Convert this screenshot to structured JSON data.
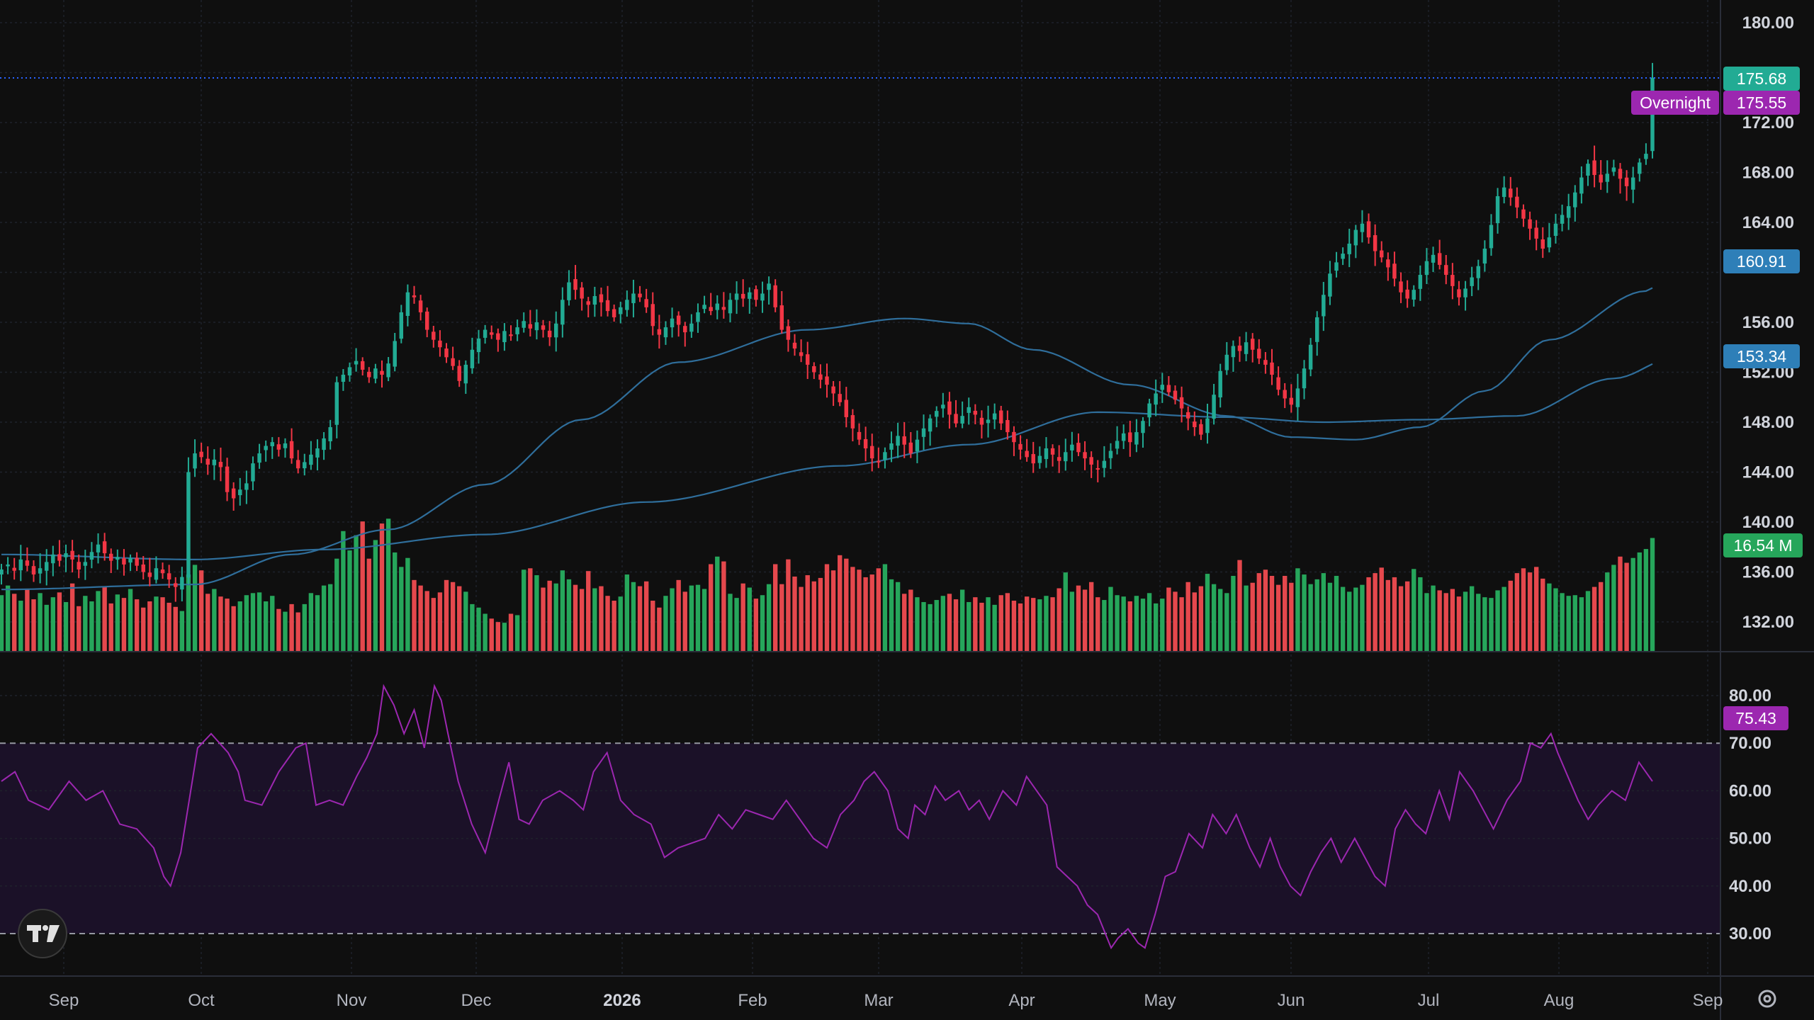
{
  "theme": {
    "background": "#0f0f0f",
    "up_color": "#22ab94",
    "down_color": "#f23645",
    "volume_up": "#26a65b",
    "volume_down": "#e5484d",
    "ma_color": "#2f6e9b",
    "rsi_color": "#9c27b0",
    "rsi_band": "#1b1128"
  },
  "header": {
    "logo_icon": "tradingview-logo-icon",
    "settings_icon": "gear-icon"
  },
  "price_axis": {
    "labels": [
      "180.00",
      "172.00",
      "168.00",
      "164.00",
      "156.00",
      "152.00",
      "148.00",
      "144.00",
      "140.00",
      "136.00",
      "132.00"
    ],
    "values": [
      180,
      172,
      168,
      164,
      156,
      152,
      148,
      144,
      140,
      136,
      132
    ]
  },
  "rsi_axis": {
    "labels": [
      "80.00",
      "70.00",
      "60.00",
      "50.00",
      "40.00",
      "30.00"
    ],
    "values": [
      80,
      70,
      60,
      50,
      40,
      30
    ]
  },
  "time_axis": {
    "labels": [
      "Sep",
      "Oct",
      "Nov",
      "Dec",
      "2026",
      "Feb",
      "Mar",
      "Apr",
      "May",
      "Jun",
      "Jul",
      "Aug",
      "Sep"
    ],
    "bold_index": 4
  },
  "tags": {
    "last_price": "175.68",
    "overnight_label": "Overnight",
    "overnight_price": "175.55",
    "ma_short": "160.91",
    "ma_long": "153.34",
    "volume": "16.54 M",
    "rsi": "75.43"
  },
  "chart_data": [
    {
      "type": "candlestick",
      "name": "price",
      "x_range": [
        "Sep",
        "Aug"
      ],
      "ylim": [
        130,
        182
      ],
      "closes": [
        136.2,
        136.6,
        136.1,
        137.0,
        136.5,
        135.8,
        136.3,
        136.8,
        137.4,
        136.9,
        137.5,
        137.0,
        136.2,
        136.8,
        137.6,
        138.2,
        137.5,
        136.9,
        137.2,
        136.6,
        137.1,
        136.5,
        136.0,
        135.6,
        136.3,
        135.9,
        135.4,
        134.8,
        135.6,
        144.0,
        145.5,
        145.2,
        144.6,
        145.0,
        144.4,
        142.4,
        141.9,
        142.6,
        143.1,
        144.7,
        145.5,
        146.1,
        146.4,
        145.8,
        146.3,
        145.1,
        144.3,
        144.8,
        145.4,
        145.9,
        146.7,
        147.6,
        151.2,
        151.8,
        152.4,
        152.9,
        152.2,
        151.6,
        152.3,
        151.8,
        152.7,
        154.5,
        156.8,
        158.4,
        158.0,
        156.8,
        155.4,
        154.6,
        154.0,
        153.2,
        152.5,
        151.3,
        152.6,
        153.8,
        154.7,
        155.4,
        155.0,
        154.6,
        155.3,
        154.9,
        155.6,
        156.1,
        155.5,
        156.0,
        155.4,
        154.8,
        155.9,
        157.8,
        159.2,
        158.6,
        157.9,
        157.4,
        158.1,
        157.6,
        156.9,
        156.4,
        157.2,
        157.8,
        158.3,
        158.0,
        157.2,
        155.7,
        155.0,
        155.6,
        156.3,
        155.8,
        155.2,
        155.9,
        156.8,
        157.4,
        156.9,
        157.5,
        157.0,
        157.8,
        158.3,
        157.9,
        158.4,
        157.8,
        158.3,
        159.1,
        157.2,
        155.4,
        154.6,
        153.9,
        153.3,
        152.6,
        152.0,
        151.4,
        151.0,
        150.3,
        149.6,
        148.4,
        147.5,
        146.6,
        145.9,
        145.1,
        144.8,
        145.6,
        146.3,
        146.9,
        146.2,
        145.5,
        146.6,
        147.5,
        148.3,
        148.9,
        149.4,
        148.6,
        147.9,
        148.5,
        149.2,
        148.6,
        147.8,
        148.2,
        148.7,
        147.9,
        147.2,
        146.4,
        145.8,
        145.2,
        144.7,
        145.3,
        145.9,
        145.4,
        144.9,
        145.6,
        146.2,
        145.6,
        145.1,
        144.6,
        144.2,
        144.9,
        145.7,
        146.5,
        147.1,
        146.4,
        147.2,
        148.1,
        149.5,
        150.3,
        151.0,
        150.4,
        149.8,
        149.1,
        148.3,
        147.6,
        147.0,
        148.3,
        150.2,
        152.1,
        153.4,
        154.1,
        153.7,
        154.4,
        153.8,
        153.1,
        152.6,
        151.8,
        150.6,
        149.9,
        149.4,
        150.7,
        152.3,
        154.2,
        156.4,
        158.2,
        159.9,
        160.8,
        161.5,
        162.3,
        163.4,
        163.9,
        162.8,
        161.7,
        161.2,
        160.4,
        159.5,
        158.4,
        157.9,
        158.6,
        159.8,
        160.9,
        161.4,
        160.6,
        159.8,
        158.9,
        158.0,
        158.7,
        159.6,
        160.5,
        161.9,
        163.8,
        166.1,
        166.8,
        166.0,
        165.2,
        164.3,
        163.5,
        162.7,
        161.9,
        162.8,
        163.9,
        164.6,
        165.3,
        166.4,
        167.6,
        168.7,
        167.8,
        167.2,
        167.9,
        168.4,
        167.5,
        166.9,
        167.6,
        168.8,
        169.5,
        175.6
      ]
    },
    {
      "type": "line",
      "name": "moving-average-short",
      "y_anchor": [
        [
          0,
          134.6
        ],
        [
          30,
          135.0
        ],
        [
          45,
          137.4
        ],
        [
          60,
          139.4
        ],
        [
          75,
          143.0
        ],
        [
          90,
          148.2
        ],
        [
          105,
          152.8
        ],
        [
          125,
          155.4
        ],
        [
          140,
          156.3
        ],
        [
          150,
          155.9
        ],
        [
          160,
          153.8
        ],
        [
          175,
          151.0
        ],
        [
          190,
          148.5
        ],
        [
          200,
          146.8
        ],
        [
          210,
          146.6
        ],
        [
          220,
          147.6
        ],
        [
          230,
          150.5
        ],
        [
          240,
          154.6
        ],
        [
          255,
          158.5
        ],
        [
          260,
          160.9
        ]
      ]
    },
    {
      "type": "line",
      "name": "moving-average-long",
      "y_anchor": [
        [
          0,
          137.4
        ],
        [
          30,
          137.0
        ],
        [
          50,
          137.8
        ],
        [
          75,
          139.0
        ],
        [
          100,
          141.6
        ],
        [
          130,
          144.5
        ],
        [
          150,
          146.2
        ],
        [
          170,
          148.8
        ],
        [
          190,
          148.4
        ],
        [
          205,
          148.0
        ],
        [
          220,
          148.2
        ],
        [
          235,
          148.5
        ],
        [
          250,
          151.5
        ],
        [
          260,
          153.3
        ]
      ]
    },
    {
      "type": "bar",
      "name": "volume",
      "ylim": [
        0,
        22
      ],
      "values": [
        8.2,
        9.6,
        8.4,
        7.4,
        9.0,
        7.6,
        8.5,
        6.8,
        7.9,
        8.6,
        7.2,
        9.9,
        6.6,
        8.1,
        7.3,
        8.8,
        9.4,
        7.0,
        8.3,
        7.8,
        9.1,
        7.6,
        6.4,
        7.3,
        8.0,
        7.9,
        7.1,
        6.5,
        5.9,
        11.2,
        12.6,
        11.8,
        8.4,
        9.1,
        8.0,
        7.7,
        6.6,
        7.3,
        8.2,
        8.5,
        8.6,
        7.3,
        8.1,
        6.2,
        5.8,
        6.9,
        5.7,
        6.9,
        8.5,
        8.2,
        9.6,
        9.8,
        13.5,
        17.5,
        14.7,
        16.9,
        18.9,
        13.5,
        16.2,
        18.6,
        19.3,
        14.4,
        12.3,
        13.6,
        10.4,
        9.6,
        8.8,
        7.8,
        8.6,
        10.4,
        10.1,
        9.5,
        8.7,
        6.9,
        6.4,
        5.5,
        4.8,
        4.3,
        4.2,
        5.5,
        5.3,
        11.9,
        12.1,
        11.1,
        9.3,
        10.3,
        9.9,
        11.8,
        10.5,
        9.7,
        9.1,
        11.7,
        9.2,
        9.5,
        8.1,
        7.4,
        8.0,
        11.2,
        10.1,
        9.5,
        10.2,
        7.4,
        6.4,
        8.1,
        9.2,
        10.4,
        8.7,
        9.6,
        9.7,
        9.1,
        12.7,
        13.8,
        13.1,
        8.4,
        7.8,
        9.9,
        9.3,
        7.7,
        8.2,
        9.8,
        12.7,
        9.8,
        13.4,
        10.9,
        9.4,
        11.1,
        10.2,
        10.7,
        12.7,
        11.8,
        14.0,
        13.5,
        12.3,
        11.9,
        10.8,
        11.2,
        12.1,
        12.7,
        10.5,
        10.1,
        8.4,
        9.0,
        7.9,
        7.2,
        6.9,
        7.5,
        8.1,
        8.4,
        7.6,
        9.0,
        7.2,
        7.9,
        7.1,
        7.9,
        6.8,
        8.2,
        8.5,
        7.4,
        7.0,
        8.0,
        7.8,
        7.6,
        8.1,
        7.9,
        9.2,
        11.5,
        8.7,
        9.6,
        9.0,
        10.1,
        7.9,
        7.5,
        9.4,
        8.2,
        8.0,
        7.3,
        8.1,
        7.7,
        8.5,
        7.0,
        7.7,
        9.3,
        8.7,
        7.9,
        10.1,
        8.6,
        9.5,
        11.3,
        9.8,
        9.1,
        8.5,
        11.0,
        13.3,
        9.6,
        10.0,
        11.4,
        11.9,
        11.0,
        9.7,
        11.0,
        10.0,
        12.1,
        11.2,
        9.8,
        10.5,
        11.4,
        10.0,
        11.0,
        9.4,
        8.7,
        9.3,
        9.7,
        10.8,
        11.4,
        12.2,
        10.4,
        10.8,
        9.5,
        10.2,
        12.0,
        10.8,
        8.5,
        9.6,
        8.9,
        8.5,
        9.1,
        8.0,
        8.7,
        9.5,
        8.4,
        7.9,
        7.8,
        8.9,
        9.4,
        10.3,
        11.4,
        12.1,
        11.5,
        12.3,
        10.6,
        9.9,
        9.2,
        8.5,
        8.1,
        8.2,
        7.9,
        8.8,
        9.4,
        10.1,
        11.5,
        12.6,
        13.8,
        12.9,
        13.6,
        14.4,
        14.9,
        16.5
      ]
    },
    {
      "type": "line",
      "name": "rsi",
      "ylim": [
        25,
        85
      ],
      "upper_band": 70,
      "lower_band": 30,
      "anchor": [
        [
          0,
          62
        ],
        [
          4,
          64
        ],
        [
          8,
          58
        ],
        [
          14,
          56
        ],
        [
          20,
          62
        ],
        [
          25,
          58
        ],
        [
          30,
          60
        ],
        [
          35,
          53
        ],
        [
          40,
          52
        ],
        [
          45,
          48
        ],
        [
          48,
          42
        ],
        [
          50,
          40
        ],
        [
          53,
          47
        ],
        [
          58,
          69
        ],
        [
          62,
          72
        ],
        [
          67,
          68
        ],
        [
          70,
          64
        ],
        [
          72,
          58
        ],
        [
          77,
          57
        ],
        [
          82,
          64
        ],
        [
          87,
          69
        ],
        [
          90,
          70
        ],
        [
          93,
          57
        ],
        [
          97,
          58
        ],
        [
          101,
          57
        ],
        [
          105,
          63
        ],
        [
          108,
          67
        ],
        [
          111,
          72
        ],
        [
          113,
          82
        ],
        [
          116,
          78
        ],
        [
          119,
          72
        ],
        [
          122,
          77
        ],
        [
          125,
          69
        ],
        [
          128,
          82
        ],
        [
          130,
          79
        ],
        [
          132,
          72
        ],
        [
          135,
          62
        ],
        [
          139,
          53
        ],
        [
          143,
          47
        ],
        [
          147,
          58
        ],
        [
          150,
          66
        ],
        [
          153,
          54
        ],
        [
          156,
          53
        ],
        [
          160,
          58
        ],
        [
          165,
          60
        ],
        [
          169,
          58
        ],
        [
          172,
          56
        ],
        [
          175,
          64
        ],
        [
          179,
          68
        ],
        [
          183,
          58
        ],
        [
          187,
          55
        ],
        [
          192,
          53
        ],
        [
          196,
          46
        ],
        [
          200,
          48
        ],
        [
          204,
          49
        ],
        [
          208,
          50
        ],
        [
          212,
          55
        ],
        [
          216,
          52
        ],
        [
          220,
          56
        ],
        [
          224,
          55
        ],
        [
          228,
          54
        ],
        [
          232,
          58
        ],
        [
          236,
          54
        ],
        [
          240,
          50
        ],
        [
          244,
          48
        ],
        [
          248,
          55
        ],
        [
          252,
          58
        ],
        [
          255,
          62
        ],
        [
          258,
          64
        ],
        [
          262,
          60
        ],
        [
          265,
          52
        ],
        [
          268,
          50
        ],
        [
          270,
          57
        ],
        [
          273,
          55
        ],
        [
          276,
          61
        ],
        [
          279,
          58
        ],
        [
          283,
          60
        ],
        [
          286,
          56
        ],
        [
          289,
          58
        ],
        [
          292,
          54
        ],
        [
          296,
          60
        ],
        [
          300,
          57
        ],
        [
          303,
          63
        ],
        [
          306,
          60
        ],
        [
          309,
          57
        ],
        [
          312,
          44
        ],
        [
          315,
          42
        ],
        [
          318,
          40
        ],
        [
          321,
          36
        ],
        [
          324,
          34
        ],
        [
          328,
          27
        ],
        [
          330,
          29
        ],
        [
          333,
          31
        ],
        [
          336,
          28
        ],
        [
          338,
          27
        ],
        [
          341,
          34
        ],
        [
          344,
          42
        ],
        [
          347,
          43
        ],
        [
          351,
          51
        ],
        [
          355,
          48
        ],
        [
          358,
          55
        ],
        [
          362,
          51
        ],
        [
          365,
          55
        ],
        [
          369,
          48
        ],
        [
          372,
          44
        ],
        [
          375,
          50
        ],
        [
          378,
          44
        ],
        [
          381,
          40
        ],
        [
          384,
          38
        ],
        [
          387,
          43
        ],
        [
          390,
          47
        ],
        [
          393,
          50
        ],
        [
          396,
          45
        ],
        [
          400,
          50
        ],
        [
          403,
          46
        ],
        [
          406,
          42
        ],
        [
          409,
          40
        ],
        [
          412,
          52
        ],
        [
          415,
          56
        ],
        [
          418,
          53
        ],
        [
          421,
          51
        ],
        [
          425,
          60
        ],
        [
          428,
          54
        ],
        [
          431,
          64
        ],
        [
          435,
          60
        ],
        [
          438,
          56
        ],
        [
          441,
          52
        ],
        [
          445,
          58
        ],
        [
          449,
          62
        ],
        [
          452,
          70
        ],
        [
          455,
          69
        ],
        [
          458,
          72
        ],
        [
          460,
          68
        ],
        [
          463,
          63
        ],
        [
          466,
          58
        ],
        [
          469,
          54
        ],
        [
          472,
          57
        ],
        [
          476,
          60
        ],
        [
          480,
          58
        ],
        [
          484,
          66
        ],
        [
          488,
          62
        ]
      ]
    }
  ]
}
